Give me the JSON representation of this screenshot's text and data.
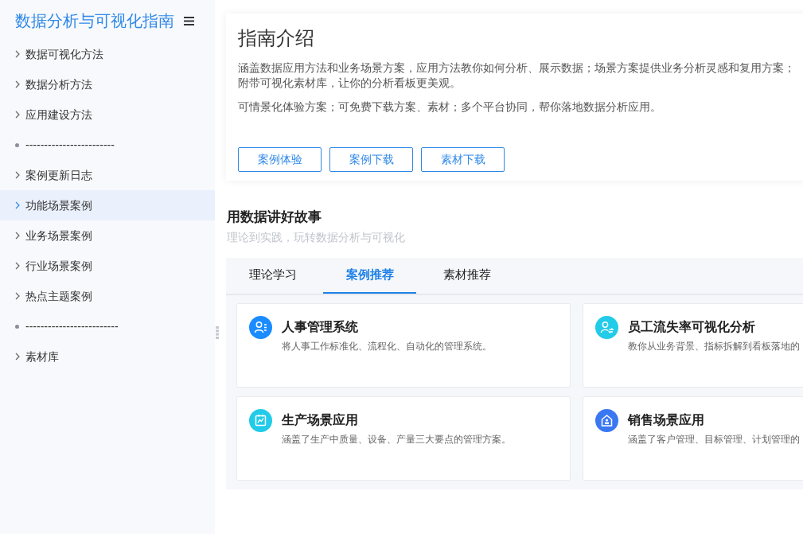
{
  "sidebar": {
    "title": "数据分析与可视化指南",
    "items": [
      {
        "kind": "link",
        "label": "数据可视化方法",
        "selected": false
      },
      {
        "kind": "link",
        "label": "数据分析方法",
        "selected": false
      },
      {
        "kind": "link",
        "label": "应用建设方法",
        "selected": false
      },
      {
        "kind": "separator",
        "label": "------------------------",
        "selected": false
      },
      {
        "kind": "link",
        "label": "案例更新日志",
        "selected": false
      },
      {
        "kind": "link",
        "label": "功能场景案例",
        "selected": true
      },
      {
        "kind": "link",
        "label": "业务场景案例",
        "selected": false
      },
      {
        "kind": "link",
        "label": "行业场景案例",
        "selected": false
      },
      {
        "kind": "link",
        "label": "热点主题案例",
        "selected": false
      },
      {
        "kind": "separator",
        "label": "-------------------------",
        "selected": false
      },
      {
        "kind": "link",
        "label": "素材库",
        "selected": false
      }
    ]
  },
  "intro": {
    "title": "指南介绍",
    "paragraphs": [
      "涵盖数据应用方法和业务场景方案，应用方法教你如何分析、展示数据；场景方案提供业务分析灵感和复用方案；附带可视化素材库，让你的分析看板更美观。",
      "可情景化体验方案；可免费下载方案、素材；多个平台协同，帮你落地数据分析应用。"
    ],
    "buttons": [
      "案例体验",
      "案例下载",
      "素材下载"
    ]
  },
  "section": {
    "title": "用数据讲好故事",
    "subtitle": "理论到实践，玩转数据分析与可视化",
    "tabs": [
      {
        "label": "理论学习",
        "selected": false
      },
      {
        "label": "案例推荐",
        "selected": true
      },
      {
        "label": "素材推荐",
        "selected": false
      }
    ],
    "cards": [
      {
        "title": "人事管理系统",
        "description": "将人事工作标准化、流程化、自动化的管理系统。",
        "color": "#1a8cff"
      },
      {
        "title": "员工流失率可视化分析",
        "description": "教你从业务背景、指标拆解到看板落地的",
        "color": "#22cbe8"
      },
      {
        "title": "生产场景应用",
        "description": "涵盖了生产中质量、设备、产量三大要点的管理方案。",
        "color": "#22cbe8"
      },
      {
        "title": "销售场景应用",
        "description": "涵盖了客户管理、目标管理、计划管理的",
        "color": "#3a78f2"
      }
    ]
  }
}
